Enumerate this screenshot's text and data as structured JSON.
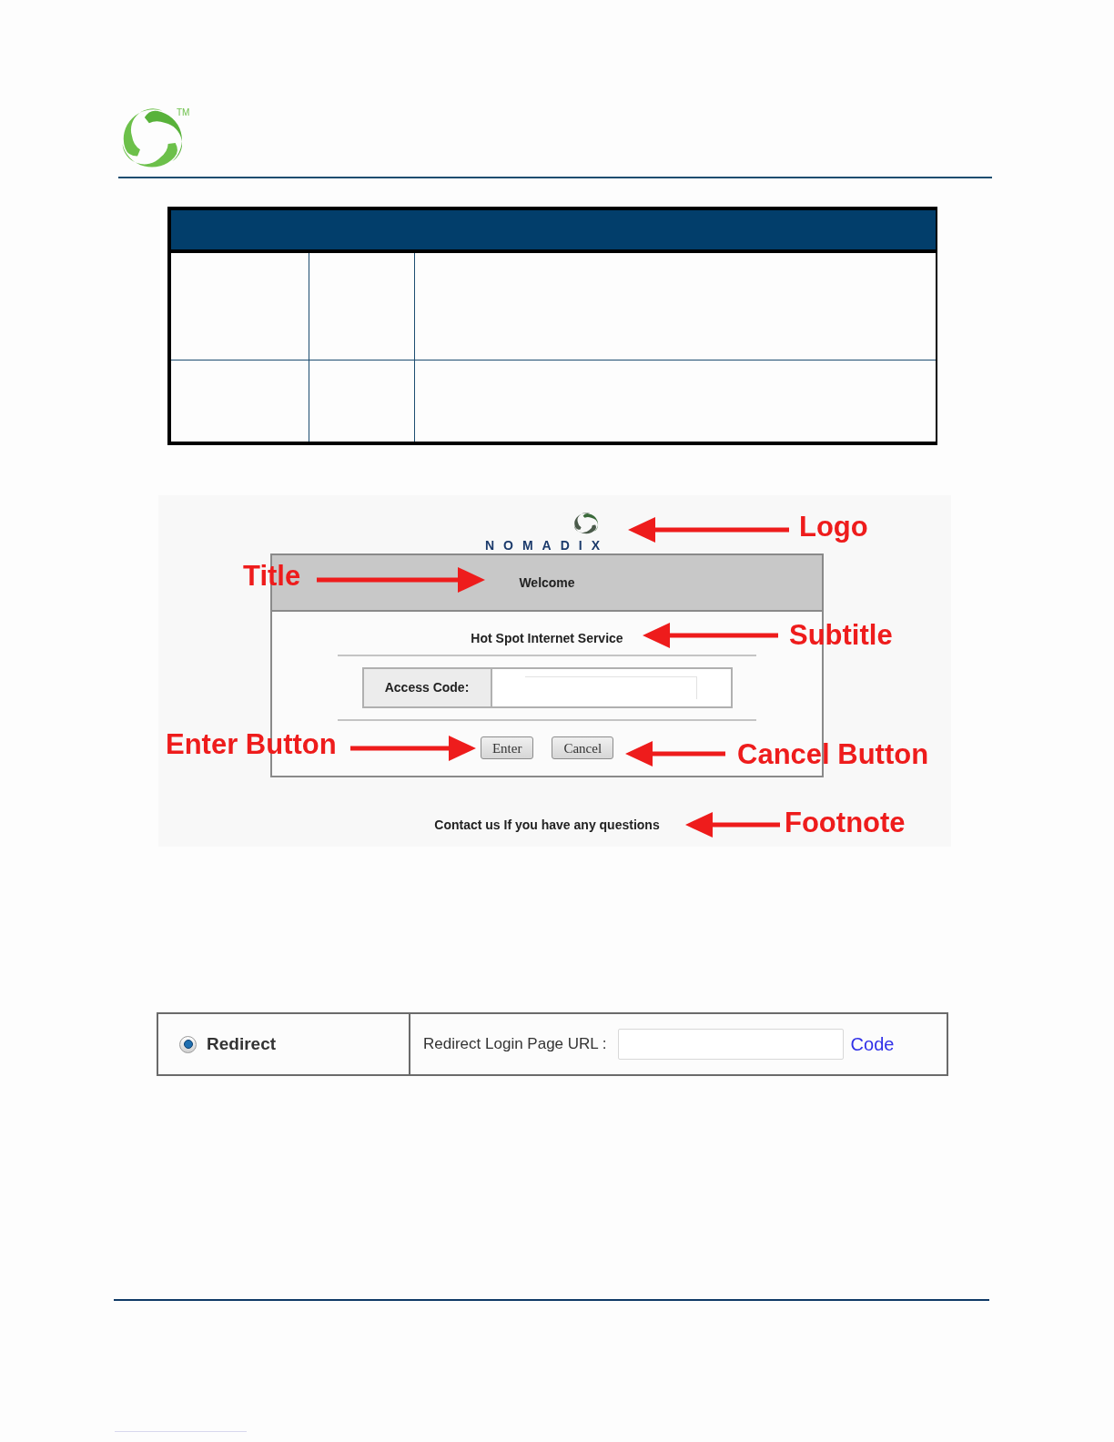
{
  "header": {
    "trademark": "TM"
  },
  "figure": {
    "brand": "NOMADIX",
    "title": "Welcome",
    "subtitle": "Hot Spot Internet Service",
    "access_code_label": "Access Code:",
    "buttons": [
      "Enter",
      "Cancel"
    ],
    "footnote": "Contact us If you have any questions",
    "callouts": [
      {
        "label": "Logo",
        "kind": "leftward"
      },
      {
        "label": "Title",
        "kind": "rightward"
      },
      {
        "label": "Subtitle",
        "kind": "leftward"
      },
      {
        "label": "Enter Button",
        "kind": "rightward"
      },
      {
        "label": "Cancel Button",
        "kind": "leftward"
      },
      {
        "label": "Footnote",
        "kind": "leftward"
      }
    ]
  },
  "redirect": {
    "option": {
      "label": "Redirect",
      "selected": true
    },
    "url_label": "Redirect Login Page URL :",
    "link": "Code"
  }
}
